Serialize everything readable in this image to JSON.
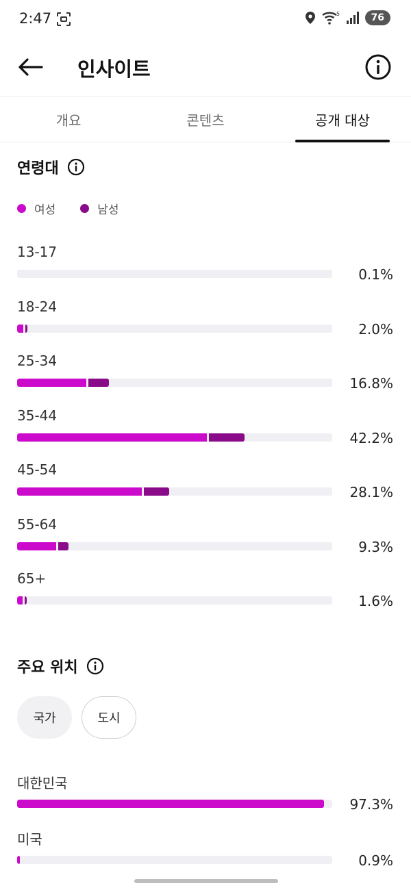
{
  "status_bar": {
    "time": "2:47",
    "battery": "76"
  },
  "header": {
    "title": "인사이트"
  },
  "tabs": [
    {
      "label": "개요",
      "active": false
    },
    {
      "label": "콘텐츠",
      "active": false
    },
    {
      "label": "공개 대상",
      "active": true
    }
  ],
  "colors": {
    "female": "#cc0acc",
    "male": "#8a0b8a",
    "track": "#f0f0f4"
  },
  "age_section": {
    "title": "연령대",
    "legend": [
      {
        "label": "여성",
        "color": "#cc0acc"
      },
      {
        "label": "남성",
        "color": "#8a0b8a"
      }
    ],
    "rows": [
      {
        "label": "13-17",
        "percent": "0.1%",
        "female": 0.0,
        "male": 0.0
      },
      {
        "label": "18-24",
        "percent": "2.0%",
        "female": 1.2,
        "male": 0.4
      },
      {
        "label": "25-34",
        "percent": "16.8%",
        "female": 13.0,
        "male": 3.8
      },
      {
        "label": "35-44",
        "percent": "42.2%",
        "female": 35.5,
        "male": 6.7
      },
      {
        "label": "45-54",
        "percent": "28.1%",
        "female": 23.4,
        "male": 4.7
      },
      {
        "label": "55-64",
        "percent": "9.3%",
        "female": 7.3,
        "male": 2.0
      },
      {
        "label": "65+",
        "percent": "1.6%",
        "female": 1.0,
        "male": 0.4
      }
    ]
  },
  "location_section": {
    "title": "주요 위치",
    "chips": [
      {
        "label": "국가",
        "selected": true
      },
      {
        "label": "도시",
        "selected": false
      }
    ],
    "rows": [
      {
        "label": "대한민국",
        "percent": "97.3%",
        "value": 97.3
      },
      {
        "label": "미국",
        "percent": "0.9%",
        "value": 0.9
      }
    ]
  }
}
